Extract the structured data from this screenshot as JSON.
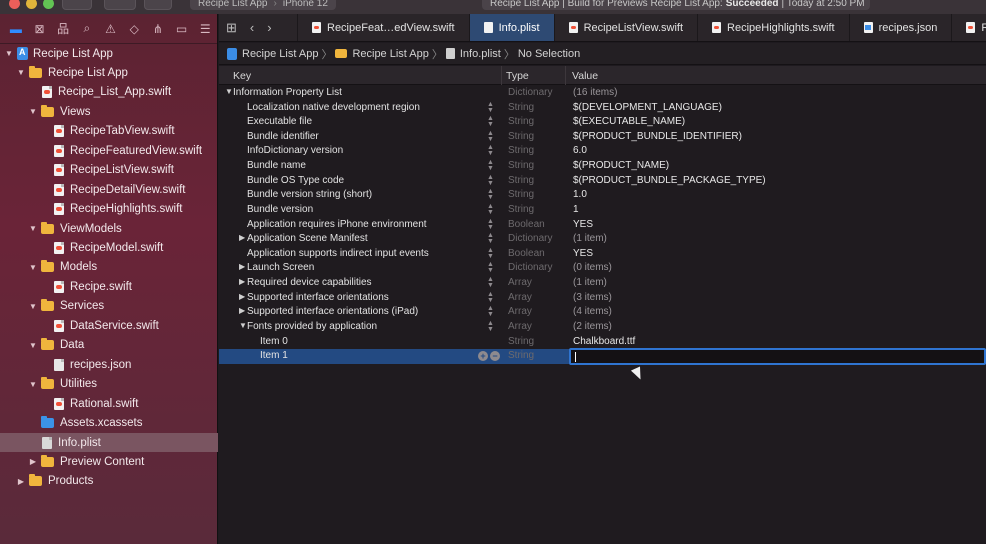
{
  "toolbar": {
    "scheme": "Recipe List App",
    "device": "iPhone 12",
    "activity_prefix": "Recipe List App | Build for Previews Recipe List App:",
    "activity_status": "Succeeded",
    "activity_suffix": "| Today at 2:50 PM"
  },
  "navigator": {
    "items": [
      {
        "label": "Recipe List App",
        "kind": "project",
        "indent": 0,
        "expanded": true
      },
      {
        "label": "Recipe List App",
        "kind": "folder",
        "indent": 1,
        "expanded": true
      },
      {
        "label": "Recipe_List_App.swift",
        "kind": "swift",
        "indent": 2
      },
      {
        "label": "Views",
        "kind": "folder",
        "indent": 2,
        "expanded": true
      },
      {
        "label": "RecipeTabView.swift",
        "kind": "swift",
        "indent": 3
      },
      {
        "label": "RecipeFeaturedView.swift",
        "kind": "swift",
        "indent": 3
      },
      {
        "label": "RecipeListView.swift",
        "kind": "swift",
        "indent": 3
      },
      {
        "label": "RecipeDetailView.swift",
        "kind": "swift",
        "indent": 3
      },
      {
        "label": "RecipeHighlights.swift",
        "kind": "swift",
        "indent": 3
      },
      {
        "label": "ViewModels",
        "kind": "folder",
        "indent": 2,
        "expanded": true
      },
      {
        "label": "RecipeModel.swift",
        "kind": "swift",
        "indent": 3
      },
      {
        "label": "Models",
        "kind": "folder",
        "indent": 2,
        "expanded": true
      },
      {
        "label": "Recipe.swift",
        "kind": "swift",
        "indent": 3
      },
      {
        "label": "Services",
        "kind": "folder",
        "indent": 2,
        "expanded": true
      },
      {
        "label": "DataService.swift",
        "kind": "swift",
        "indent": 3
      },
      {
        "label": "Data",
        "kind": "folder",
        "indent": 2,
        "expanded": true
      },
      {
        "label": "recipes.json",
        "kind": "json",
        "indent": 3
      },
      {
        "label": "Utilities",
        "kind": "folder",
        "indent": 2,
        "expanded": true
      },
      {
        "label": "Rational.swift",
        "kind": "swift",
        "indent": 3
      },
      {
        "label": "Assets.xcassets",
        "kind": "assets",
        "indent": 2
      },
      {
        "label": "Info.plist",
        "kind": "plist",
        "indent": 2,
        "selected": true
      },
      {
        "label": "Preview Content",
        "kind": "folder",
        "indent": 2,
        "expanded": false
      },
      {
        "label": "Products",
        "kind": "folder",
        "indent": 1,
        "expanded": false
      }
    ]
  },
  "tabs": [
    {
      "label": "RecipeFeat…edView.swift",
      "kind": "swift",
      "active": false
    },
    {
      "label": "Info.plist",
      "kind": "plist",
      "active": true
    },
    {
      "label": "RecipeListView.swift",
      "kind": "swift",
      "active": false
    },
    {
      "label": "RecipeHighlights.swift",
      "kind": "swift",
      "active": false
    },
    {
      "label": "recipes.json",
      "kind": "json",
      "active": false
    },
    {
      "label": "Recipe",
      "kind": "swift",
      "active": false
    }
  ],
  "jumpbar": {
    "project": "Recipe List App",
    "group": "Recipe List App",
    "file": "Info.plist",
    "selection": "No Selection"
  },
  "plist": {
    "headers": {
      "key": "Key",
      "type": "Type",
      "value": "Value"
    },
    "rows": [
      {
        "key": "Information Property List",
        "type": "Dictionary",
        "value": "(16 items)",
        "level": 0,
        "disclosure": "open",
        "stepper": false
      },
      {
        "key": "Localization native development region",
        "type": "String",
        "value": "$(DEVELOPMENT_LANGUAGE)",
        "level": 1,
        "stepper": true
      },
      {
        "key": "Executable file",
        "type": "String",
        "value": "$(EXECUTABLE_NAME)",
        "level": 1,
        "stepper": true
      },
      {
        "key": "Bundle identifier",
        "type": "String",
        "value": "$(PRODUCT_BUNDLE_IDENTIFIER)",
        "level": 1,
        "stepper": true
      },
      {
        "key": "InfoDictionary version",
        "type": "String",
        "value": "6.0",
        "level": 1,
        "stepper": true
      },
      {
        "key": "Bundle name",
        "type": "String",
        "value": "$(PRODUCT_NAME)",
        "level": 1,
        "stepper": true
      },
      {
        "key": "Bundle OS Type code",
        "type": "String",
        "value": "$(PRODUCT_BUNDLE_PACKAGE_TYPE)",
        "level": 1,
        "stepper": true
      },
      {
        "key": "Bundle version string (short)",
        "type": "String",
        "value": "1.0",
        "level": 1,
        "stepper": true
      },
      {
        "key": "Bundle version",
        "type": "String",
        "value": "1",
        "level": 1,
        "stepper": true
      },
      {
        "key": "Application requires iPhone environment",
        "type": "Boolean",
        "value": "YES",
        "level": 1,
        "stepper": true
      },
      {
        "key": "Application Scene Manifest",
        "type": "Dictionary",
        "value": "(1 item)",
        "level": 1,
        "disclosure": "closed",
        "stepper": true
      },
      {
        "key": "Application supports indirect input events",
        "type": "Boolean",
        "value": "YES",
        "level": 1,
        "stepper": true
      },
      {
        "key": "Launch Screen",
        "type": "Dictionary",
        "value": "(0 items)",
        "level": 1,
        "disclosure": "closed",
        "stepper": true
      },
      {
        "key": "Required device capabilities",
        "type": "Array",
        "value": "(1 item)",
        "level": 1,
        "disclosure": "closed",
        "stepper": true
      },
      {
        "key": "Supported interface orientations",
        "type": "Array",
        "value": "(3 items)",
        "level": 1,
        "disclosure": "closed",
        "stepper": true
      },
      {
        "key": "Supported interface orientations (iPad)",
        "type": "Array",
        "value": "(4 items)",
        "level": 1,
        "disclosure": "closed",
        "stepper": true
      },
      {
        "key": "Fonts provided by application",
        "type": "Array",
        "value": "(2 items)",
        "level": 1,
        "disclosure": "open",
        "stepper": true
      },
      {
        "key": "Item 0",
        "type": "String",
        "value": "Chalkboard.ttf",
        "level": 2,
        "stepper": false
      },
      {
        "key": "Item 1",
        "type": "String",
        "value": "",
        "level": 2,
        "stepper": false,
        "selected": true,
        "editing": true
      }
    ]
  },
  "colors": {
    "accent": "#2f74d0",
    "selected_row": "#234a82",
    "navigator_bg": "#6a2438"
  }
}
